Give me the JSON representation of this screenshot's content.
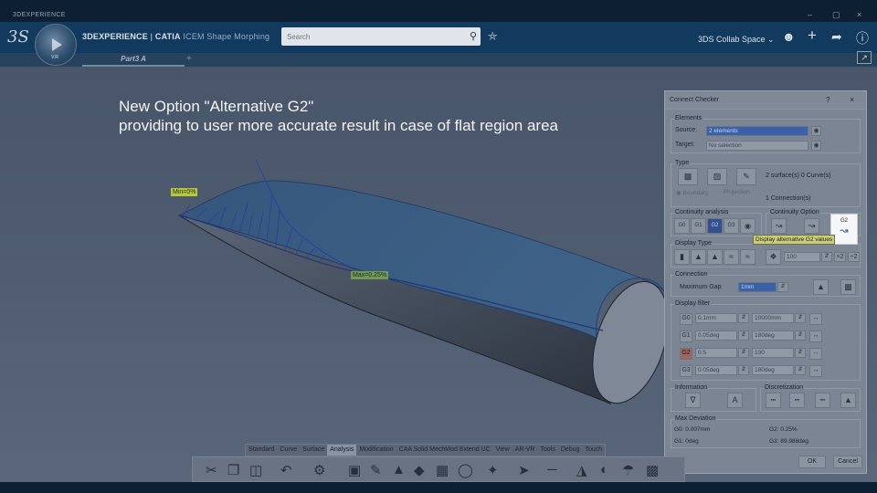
{
  "window": {
    "title": "3DEXPERIENCE",
    "min_glyph": "–",
    "max_glyph": "▢",
    "close_glyph": "×"
  },
  "header": {
    "brand_logo": "3S",
    "compass_version": "V.R",
    "app_brand": "3DEXPERIENCE",
    "app_sep": " | ",
    "app_name": "CATIA",
    "app_product": " ICEM Shape Morphing",
    "search_placeholder": "Search",
    "search_icon": "magnifier-icon",
    "collab_space": "3DS Collab Space",
    "icons": [
      "user-icon",
      "plus-icon",
      "share-icon",
      "help-icon"
    ]
  },
  "tabs": {
    "active_tab": "Part3 A",
    "add_tab_glyph": "+"
  },
  "viewport": {
    "caption_line1": "New Option \"Alternative G2\"",
    "caption_line2": "providing to user more accurate result in case of flat region area",
    "min_label": "Min=0%",
    "max_label": "Max=0.25%"
  },
  "dialog": {
    "title": "Connect Checker",
    "help_glyph": "?",
    "close_glyph": "×",
    "elements": {
      "group_title": "Elements",
      "source_label": "Source:",
      "source_value": "2 elements",
      "target_label": "Target:",
      "target_value": "No selection"
    },
    "type": {
      "group_title": "Type",
      "count_text": "2 surface(s)  0 Curve(s)",
      "opt_boundary": "Boundary",
      "opt_projection": "Projection",
      "connections": "1 Connection(s)"
    },
    "continuity_analysis": {
      "group_title": "Continuity analysis",
      "buttons": [
        "G0",
        "G1",
        "G2",
        "G3",
        "Overlap"
      ]
    },
    "continuity_option": {
      "group_title": "Continuity Option",
      "alt_g2_label": "G2",
      "tooltip": "Display alternative G2 values"
    },
    "display_type": {
      "group_title": "Display Type",
      "amplitude": "100"
    },
    "connection": {
      "group_title": "Connection",
      "max_gap_label": "Maximum Gap",
      "max_gap_value": "1mm"
    },
    "display_filter": {
      "group_title": "Display filter",
      "rows": [
        {
          "tag": "G0",
          "min": "0.1mm",
          "max": "10000mm"
        },
        {
          "tag": "G1",
          "min": "0.05deg",
          "max": "180deg"
        },
        {
          "tag": "G2",
          "min": "0.5",
          "max": "100"
        },
        {
          "tag": "G3",
          "min": "0.05deg",
          "max": "180deg"
        }
      ]
    },
    "information": {
      "group_title": "Information"
    },
    "discretization": {
      "group_title": "Discretization"
    },
    "max_deviation": {
      "group_title": "Max Deviation",
      "g0": "G0: 0.007mm",
      "g1": "G1: 0deg",
      "g2": "G2: 0.25%",
      "g3": "G3: 89.988deg"
    },
    "ok": "OK",
    "cancel": "Cancel"
  },
  "action_bar": {
    "sections": [
      "Standard",
      "Curve",
      "Surface",
      "Analysis",
      "Modification",
      "CAA Solid MechMod Extend UC",
      "View",
      "AR-VR",
      "Tools",
      "Debug",
      "Touch"
    ],
    "active_section": "Analysis"
  },
  "colors": {
    "surface_fill": "#3d5f86",
    "surface_edge": "#2a3f6e",
    "comb": "#1c2a8a",
    "label_yellow": "#b8c63a",
    "dialog_bg": "#7b8594",
    "header_bg": "#123a5e"
  }
}
